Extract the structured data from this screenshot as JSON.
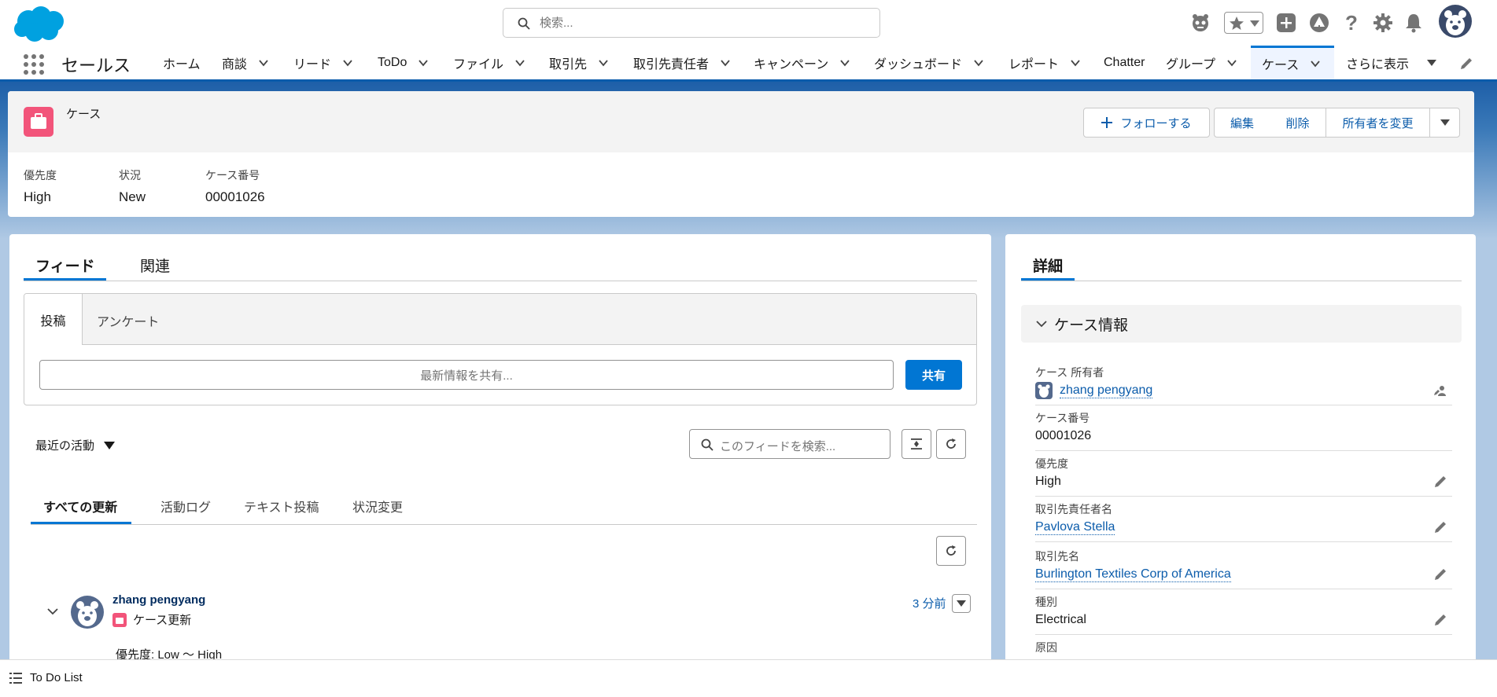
{
  "header": {
    "search_placeholder": "検索...",
    "icons": [
      "einstein-icon",
      "star-icon",
      "chevron-down-icon",
      "plus-icon",
      "trailhead-icon",
      "help-icon",
      "gear-icon",
      "bell-icon",
      "avatar"
    ]
  },
  "nav": {
    "app_name": "セールス",
    "items": [
      {
        "label": "ホーム",
        "chev": false
      },
      {
        "label": "商談",
        "chev": true
      },
      {
        "label": "リード",
        "chev": true
      },
      {
        "label": "ToDo",
        "chev": true
      },
      {
        "label": "ファイル",
        "chev": true
      },
      {
        "label": "取引先",
        "chev": true
      },
      {
        "label": "取引先責任者",
        "chev": true
      },
      {
        "label": "キャンペーン",
        "chev": true
      },
      {
        "label": "ダッシュボード",
        "chev": true
      },
      {
        "label": "レポート",
        "chev": true
      },
      {
        "label": "Chatter",
        "chev": false
      },
      {
        "label": "グループ",
        "chev": true
      },
      {
        "label": "ケース",
        "chev": true
      },
      {
        "label": "さらに表示",
        "chev": true
      }
    ]
  },
  "highlights": {
    "object_label": "ケース",
    "follow_label": "フォローする",
    "edit_label": "編集",
    "delete_label": "削除",
    "change_owner_label": "所有者を変更",
    "fields": [
      {
        "label": "優先度",
        "value": "High"
      },
      {
        "label": "状況",
        "value": "New"
      },
      {
        "label": "ケース番号",
        "value": "00001026"
      }
    ]
  },
  "feed": {
    "tab_feed": "フィード",
    "tab_related": "関連",
    "pub_tab_post": "投稿",
    "pub_tab_poll": "アンケート",
    "share_placeholder": "最新情報を共有...",
    "share_button": "共有",
    "sort_label": "最近の活動",
    "search_placeholder": "このフィードを検索...",
    "filters": [
      "すべての更新",
      "活動ログ",
      "テキスト投稿",
      "状況変更"
    ],
    "post": {
      "author": "zhang pengyang",
      "type": "ケース更新",
      "time": "3 分前",
      "body": "優先度: Low 〜 High"
    }
  },
  "details": {
    "tab_label": "詳細",
    "section_title": "ケース情報",
    "fields": [
      {
        "label": "ケース 所有者",
        "value": "zhang pengyang"
      },
      {
        "label": "ケース番号",
        "value": "00001026"
      },
      {
        "label": "優先度",
        "value": "High"
      },
      {
        "label": "取引先責任者名",
        "value": "Pavlova Stella"
      },
      {
        "label": "取引先名",
        "value": "Burlington Textiles Corp of America"
      },
      {
        "label": "種別",
        "value": "Electrical"
      },
      {
        "label": "原因",
        "value": ""
      }
    ]
  },
  "utility": {
    "todo_label": "To Do List"
  },
  "colors": {
    "brand": "#0176d3",
    "case": "#f2547a",
    "link": "#0b5cab"
  }
}
